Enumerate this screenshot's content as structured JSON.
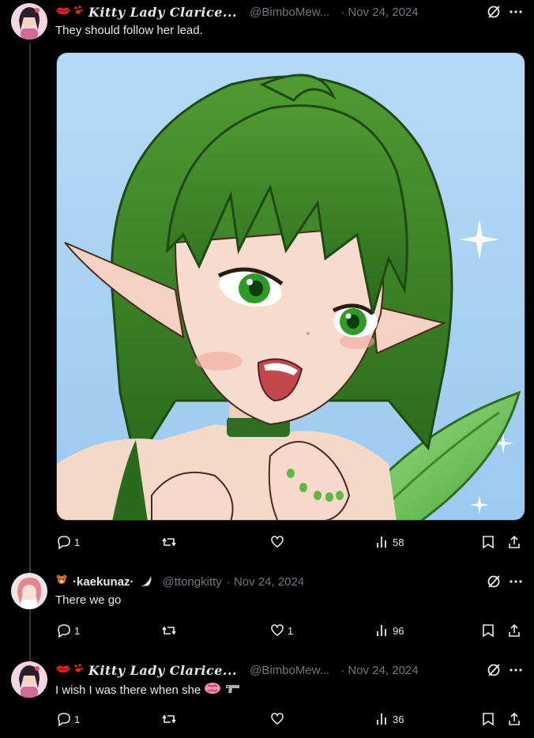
{
  "posts": [
    {
      "display_name": "Kitty Lady Clarice...",
      "handle": "@BimboMew...",
      "date": "· Nov 24, 2024",
      "text": "They should follow her lead.",
      "stats": {
        "replies": "1",
        "reposts": "",
        "likes": "",
        "views": "58"
      }
    },
    {
      "display_name": "·kaekunaz·",
      "handle": "@ttongkitty",
      "date": "· Nov 24, 2024",
      "text": "There we go",
      "stats": {
        "replies": "1",
        "reposts": "",
        "likes": "1",
        "views": "96"
      }
    },
    {
      "display_name": "Kitty Lady Clarice...",
      "handle": "@BimboMew...",
      "date": "· Nov 24, 2024",
      "text": "I wish I was there when she",
      "stats": {
        "replies": "1",
        "reposts": "",
        "likes": "",
        "views": "36"
      }
    }
  ],
  "icons": {
    "lips": "lips-icon",
    "paws": "paw-icon",
    "grok": "grok-icon",
    "more": "more-icon",
    "reply": "reply-icon",
    "repost": "repost-icon",
    "like": "heart-icon",
    "views": "views-icon",
    "bookmark": "bookmark-icon",
    "share": "share-icon",
    "brain": "brain-emoji",
    "gun": "water-pistol-emoji",
    "bear": "teddy-bear-emoji",
    "sparkle": "sparkle-emoji"
  },
  "colors": {
    "background": "#000000",
    "text": "#e7e9ea",
    "muted": "#71767b",
    "divider": "#333639",
    "media_sky": "#a7d3f4",
    "hair_green": "#3f8a28"
  }
}
